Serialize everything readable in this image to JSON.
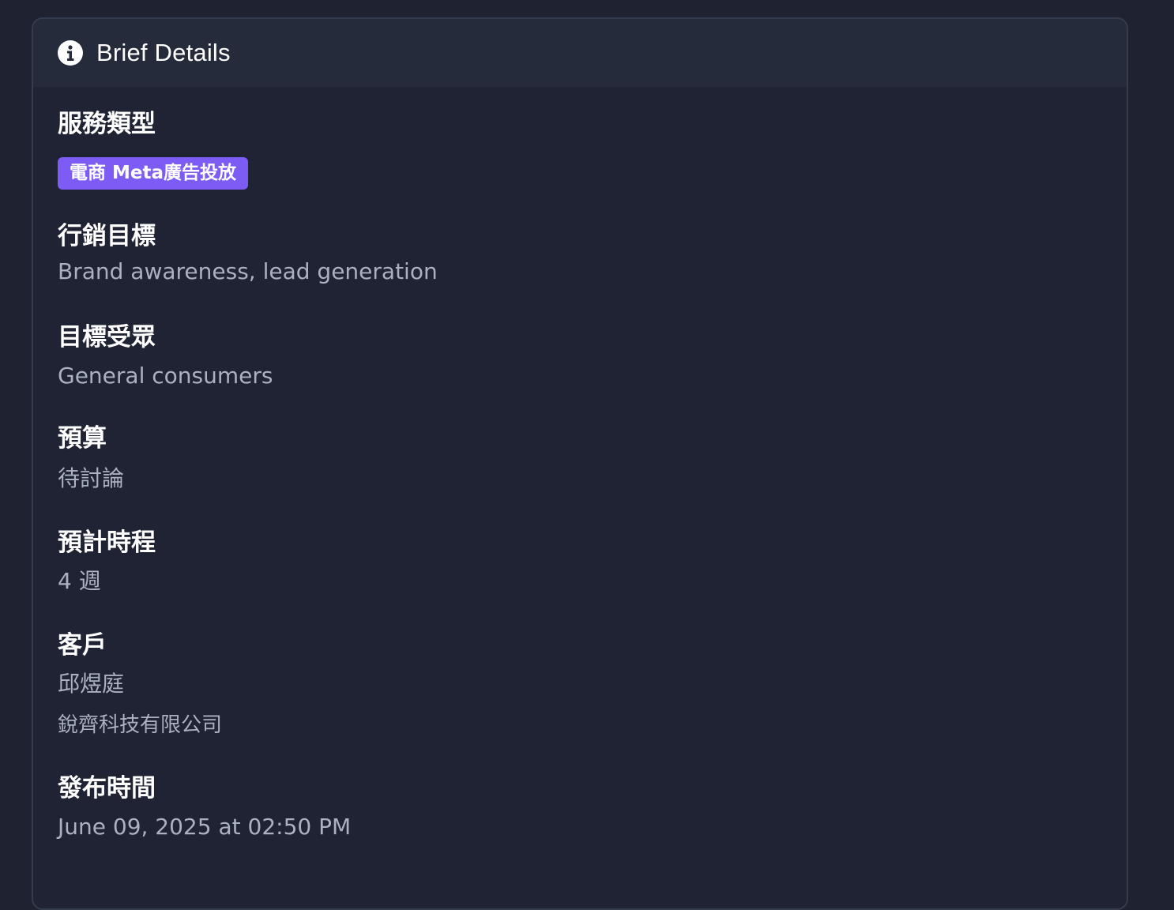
{
  "card": {
    "title": "Brief Details",
    "icon": "info-circle-icon"
  },
  "fields": {
    "service_type": {
      "label": "服務類型",
      "tag": "電商 Meta廣告投放",
      "tag_color": "#7c5cf5"
    },
    "marketing_goal": {
      "label": "行銷目標",
      "value": "Brand awareness, lead generation"
    },
    "target_audience": {
      "label": "目標受眾",
      "value": "General consumers"
    },
    "budget": {
      "label": "預算",
      "value": "待討論"
    },
    "timeline": {
      "label": "預計時程",
      "value": "4 週"
    },
    "client": {
      "label": "客戶",
      "name": "邱煜庭",
      "company": "銳齊科技有限公司"
    },
    "published": {
      "label": "發布時間",
      "value": "June 09, 2025 at 02:50 PM"
    }
  }
}
